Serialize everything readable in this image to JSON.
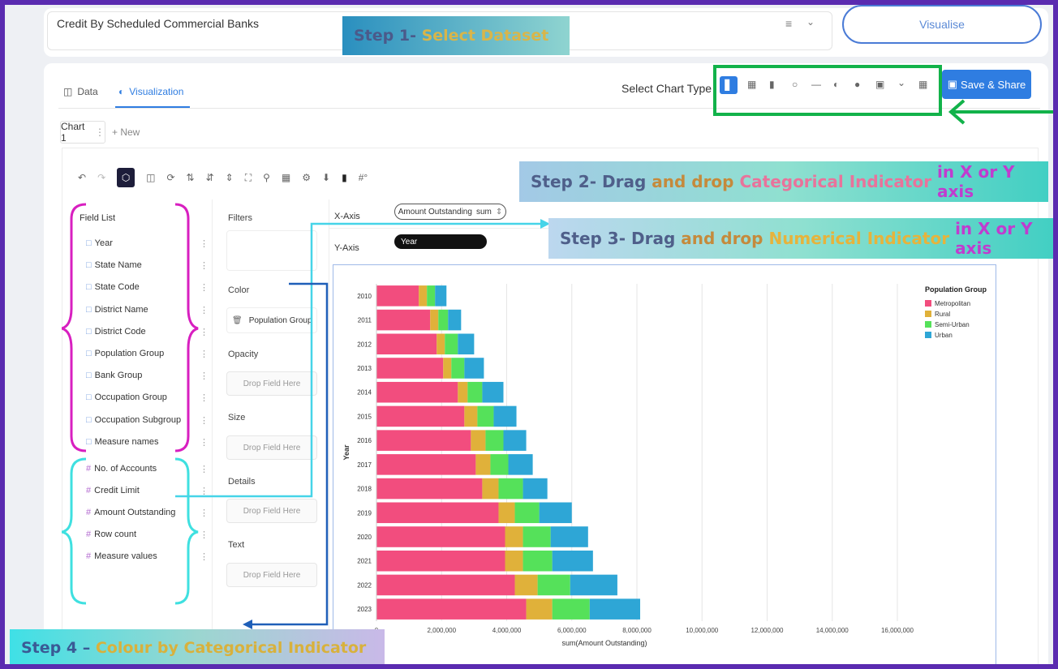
{
  "dataset": {
    "name": "Credit By Scheduled Commercial Banks",
    "visualise_label": "Visualise"
  },
  "tabs": {
    "data": "Data",
    "visualization": "Visualization"
  },
  "chart_type_label": "Select Chart Type",
  "save_share": "Save & Share",
  "chart_tabs": {
    "chart1": "Chart 1",
    "new": "+ New"
  },
  "field_list": {
    "title": "Field List",
    "categorical": [
      "Year",
      "State Name",
      "State Code",
      "District Name",
      "District Code",
      "Population Group",
      "Bank Group",
      "Occupation Group",
      "Occupation Subgroup",
      "Measure names"
    ],
    "numerical": [
      "No. of Accounts",
      "Credit Limit",
      "Amount Outstanding",
      "Row count",
      "Measure values"
    ]
  },
  "shelves": {
    "filters": "Filters",
    "color": "Color",
    "color_field": "Population Group",
    "opacity": "Opacity",
    "size": "Size",
    "details": "Details",
    "text": "Text",
    "drop_placeholder": "Drop Field Here"
  },
  "axes": {
    "x_label": "X-Axis",
    "x_field": "Amount Outstanding",
    "x_agg": "sum",
    "y_label": "Y-Axis",
    "y_field": "Year"
  },
  "annotations": {
    "step1a": "Step 1- ",
    "step1b": "Select Dataset",
    "step2a": "Step 2- Drag ",
    "step2b": "and drop ",
    "step2c": "Categorical Indicator ",
    "step2d": "in X or Y axis",
    "step3a": "Step 3- Drag ",
    "step3b": "and drop ",
    "step3c": "Numerical Indicator ",
    "step3d": "in X or Y axis",
    "step4a": "Step 4 – ",
    "step4b": "Colour by Categorical Indicator"
  },
  "colors": {
    "metropolitan": "#f24d7e",
    "rural": "#e0b13a",
    "semi_urban": "#55e15a",
    "urban": "#2ea6d6",
    "accent": "#2f7de1",
    "highlight": "#12b24a"
  },
  "chart_data": {
    "type": "bar",
    "orientation": "horizontal",
    "stacked": true,
    "categories": [
      "2010",
      "2011",
      "2012",
      "2013",
      "2014",
      "2015",
      "2016",
      "2017",
      "2018",
      "2019",
      "2020",
      "2021",
      "2022",
      "2023"
    ],
    "series": [
      {
        "name": "Metropolitan",
        "values": [
          1300000,
          1650000,
          1850000,
          2050000,
          2500000,
          2700000,
          2900000,
          3050000,
          3250000,
          3750000,
          3950000,
          3950000,
          4250000,
          4600000
        ]
      },
      {
        "name": "Rural",
        "values": [
          250000,
          250000,
          250000,
          250000,
          300000,
          400000,
          450000,
          450000,
          500000,
          500000,
          550000,
          550000,
          700000,
          800000
        ]
      },
      {
        "name": "Semi-Urban",
        "values": [
          250000,
          300000,
          400000,
          400000,
          450000,
          500000,
          550000,
          550000,
          750000,
          750000,
          850000,
          900000,
          1000000,
          1150000
        ]
      },
      {
        "name": "Urban",
        "values": [
          350000,
          400000,
          500000,
          600000,
          650000,
          700000,
          700000,
          750000,
          750000,
          1000000,
          1150000,
          1250000,
          1450000,
          1550000
        ]
      }
    ],
    "xlabel": "sum(Amount Outstanding)",
    "ylabel": "Year",
    "xlim": [
      0,
      9000000
    ],
    "xticks": [
      "0",
      "2,000,000",
      "4,000,000",
      "6,000,000",
      "8,000,000",
      "10,000,000",
      "12,000,000",
      "14,000,000",
      "16,000,000"
    ],
    "legend_title": "Population Group",
    "legend_position": "top-right",
    "grid": true
  }
}
